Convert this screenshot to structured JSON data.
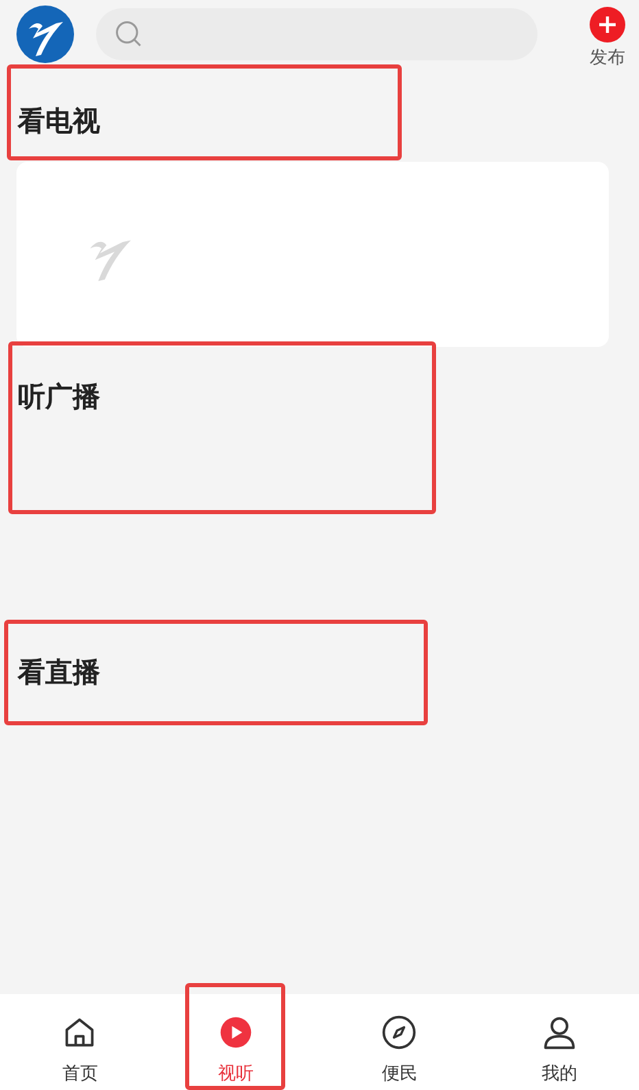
{
  "header": {
    "publish_label": "发布"
  },
  "sections": [
    {
      "title": "看电视",
      "highlighted": true,
      "kind": "card"
    },
    {
      "title": "听广播",
      "highlighted": true,
      "kind": "empty"
    },
    {
      "title": "看直播",
      "highlighted": true,
      "kind": "empty"
    }
  ],
  "tab_bar": [
    {
      "label": "首页",
      "kind": "home",
      "selected": false,
      "highlighted": false
    },
    {
      "label": "视听",
      "kind": "play",
      "selected": true,
      "highlighted": true
    },
    {
      "label": "便民",
      "kind": "compass",
      "selected": false,
      "highlighted": false
    },
    {
      "label": "我的",
      "kind": "user",
      "selected": false,
      "highlighted": false
    }
  ]
}
